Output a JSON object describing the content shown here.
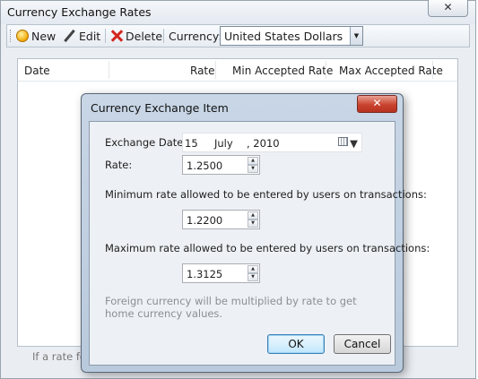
{
  "window": {
    "title": "Currency Exchange Rates",
    "close_glyph": "✕"
  },
  "toolbar": {
    "new_label": "New",
    "edit_label": "Edit",
    "delete_label": "Delete",
    "currency_label": "Currency:",
    "currency_value": "United States Dollars"
  },
  "grid": {
    "columns": [
      "Date",
      "Rate",
      "Min Accepted Rate",
      "Max Accepted Rate"
    ]
  },
  "hint_text": "If a rate fo",
  "dialog": {
    "title": "Currency Exchange Item",
    "close_glyph": "✕",
    "exchange_date_label": "Exchange Date:",
    "date": {
      "day": "15",
      "month": "July",
      "year": ", 2010"
    },
    "rate_label": "Rate:",
    "rate_value": "1.2500",
    "min_label": "Minimum rate allowed to be entered by users on transactions:",
    "min_value": "1.2200",
    "max_label": "Maximum rate allowed to be entered by users on transactions:",
    "max_value": "1.3125",
    "note": "Foreign currency will be multiplied by rate to get home currency values.",
    "ok_label": "OK",
    "cancel_label": "Cancel"
  },
  "colors": {
    "dialog_frame": "#c3d3e5",
    "close_red": "#c9432f",
    "ok_border": "#3c7fb1"
  }
}
